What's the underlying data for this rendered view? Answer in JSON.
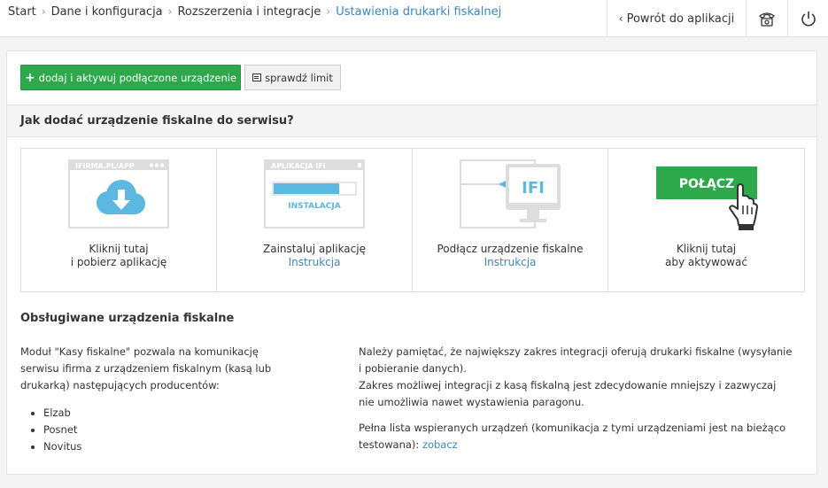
{
  "breadcrumb": {
    "items": [
      "Start",
      "Dane i konfiguracja",
      "Rozszerzenia i integracje"
    ],
    "active": "Ustawienia drukarki fiskalnej"
  },
  "header": {
    "back_label": "Powrót do aplikacji",
    "phone_icon": "phone-icon",
    "power_icon": "power-icon"
  },
  "toolbar": {
    "add_label": "dodaj i aktywuj podłączone urządzenie",
    "limit_label": "sprawdź limit"
  },
  "how": {
    "title": "Jak dodać urządzenie fiskalne do serwisu?"
  },
  "steps": [
    {
      "line1": "Kliknij tutaj",
      "line2": "i pobierz aplikację",
      "art_text": "IFIRMA.PL/APP"
    },
    {
      "line1": "Zainstaluj aplikację",
      "link": "Instrukcja",
      "art_text": "APLIKACJA IFI",
      "art_sub": "INSTALACJA"
    },
    {
      "line1": "Podłącz urządzenie fiskalne",
      "link": "Instrukcja",
      "art_text": "IFI"
    },
    {
      "line1": "Kliknij tutaj",
      "line2": "aby aktywować",
      "art_text": "POŁĄCZ"
    }
  ],
  "supported": {
    "title": "Obsługiwane urządzenia fiskalne",
    "intro": "Moduł \"Kasy fiskalne\" pozwala na komunikację serwisu ifirma z urządzeniem fiskalnym (kasą lub drukarką) następujących producentów:",
    "brands": [
      "Elzab",
      "Posnet",
      "Novitus"
    ],
    "note1": "Należy pamiętać, że największy zakres integracji oferują drukarki fiskalne (wysyłanie i pobieranie danych).",
    "note2": "Zakres możliwej integracji z kasą fiskalną jest zdecydowanie mniejszy i zazwyczaj nie umożliwia nawet wystawienia paragonu.",
    "note3": "Pełna lista wspieranych urządzeń (komunikacja z tymi urządzeniami jest na bieżąco testowana):",
    "note3_link": "zobacz"
  },
  "colors": {
    "accent": "#3a87c5",
    "green": "#2da84a",
    "cloud": "#5bb8e0"
  }
}
